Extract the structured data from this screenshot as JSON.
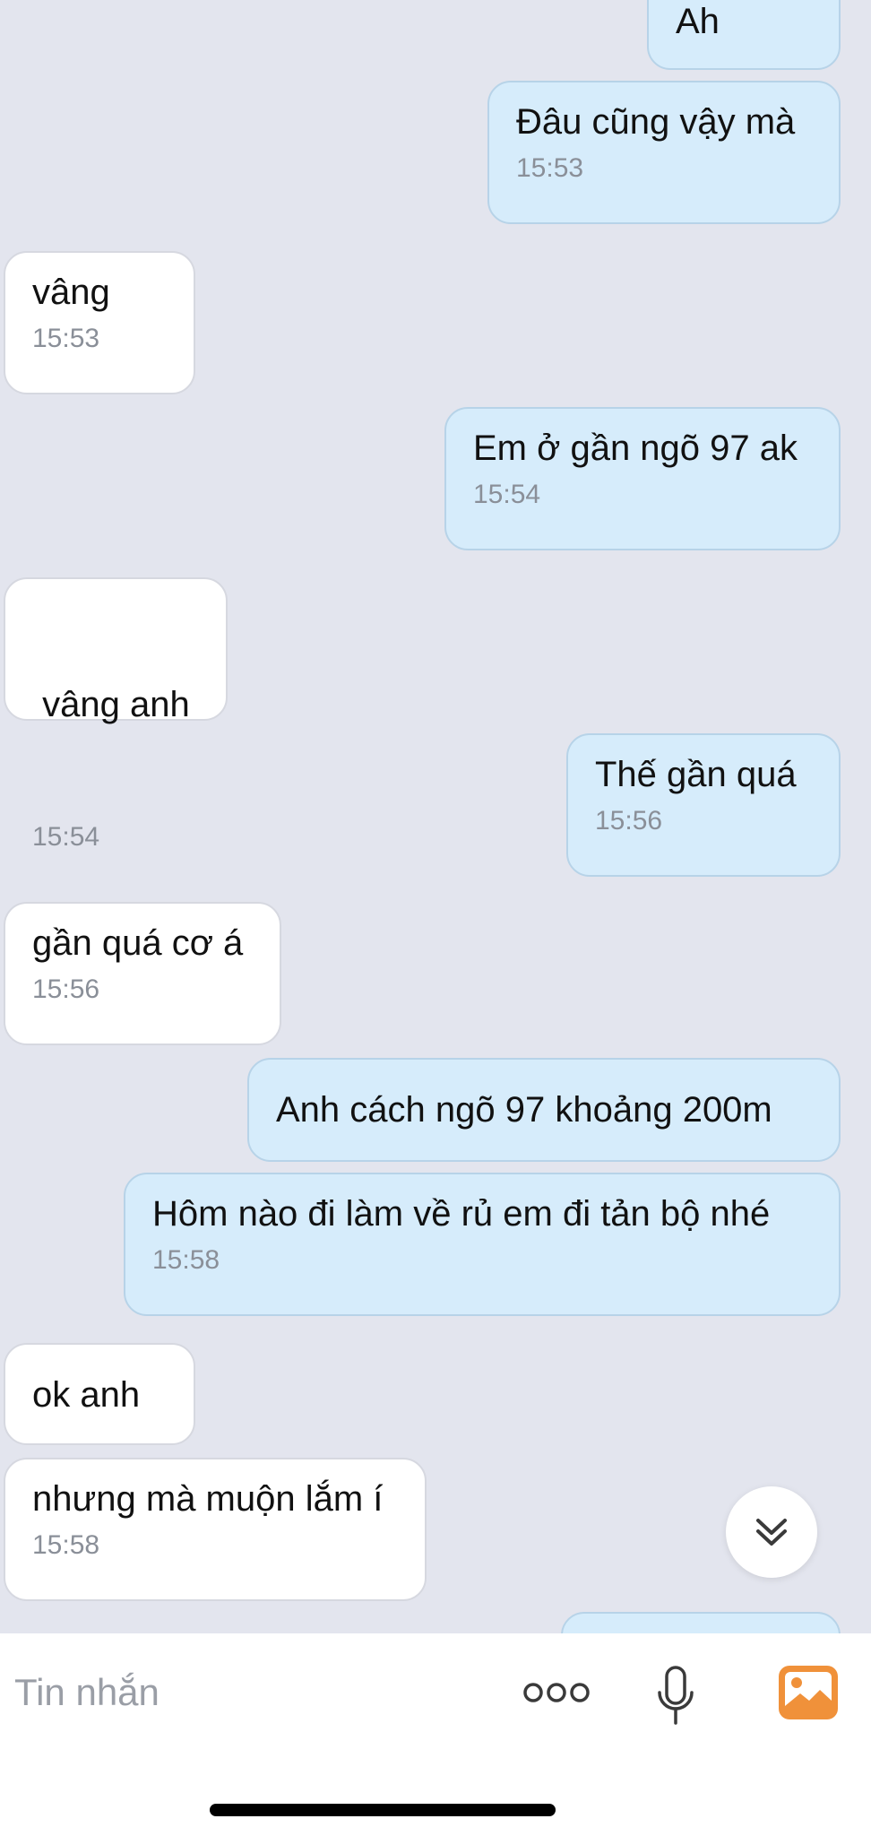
{
  "messages": [
    {
      "side": "out",
      "text": "Ah",
      "time": ""
    },
    {
      "side": "out",
      "text": "Đâu cũng vậy mà",
      "time": "15:53"
    },
    {
      "side": "in",
      "text": "vâng",
      "time": "15:53"
    },
    {
      "side": "out",
      "text": "Em ở gần ngõ 97 ak",
      "time": "15:54"
    },
    {
      "side": "in",
      "text": " vâng anh",
      "time": "15:54"
    },
    {
      "side": "out",
      "text": "Thế gần quá",
      "time": "15:56"
    },
    {
      "side": "in",
      "text": "gần quá cơ á",
      "time": "15:56"
    },
    {
      "side": "out",
      "text": "Anh cách ngõ 97 khoảng 200m",
      "time": ""
    },
    {
      "side": "out",
      "text": "Hôm nào đi làm về rủ em đi tản bộ nhé",
      "time": "15:58"
    },
    {
      "side": "in",
      "text": "ok anh",
      "time": ""
    },
    {
      "side": "in",
      "text": "nhưng mà muộn lắm í",
      "time": "15:58"
    }
  ],
  "composer": {
    "placeholder": "Tin nhắn",
    "icons": [
      "more-icon",
      "microphone-icon",
      "image-icon"
    ]
  },
  "colors": {
    "chat_background": "#e3e5ee",
    "outgoing_bubble": "#d6ecfb",
    "incoming_bubble": "#ffffff",
    "timestamp": "#8a8f98",
    "image_icon": "#f0913a"
  }
}
